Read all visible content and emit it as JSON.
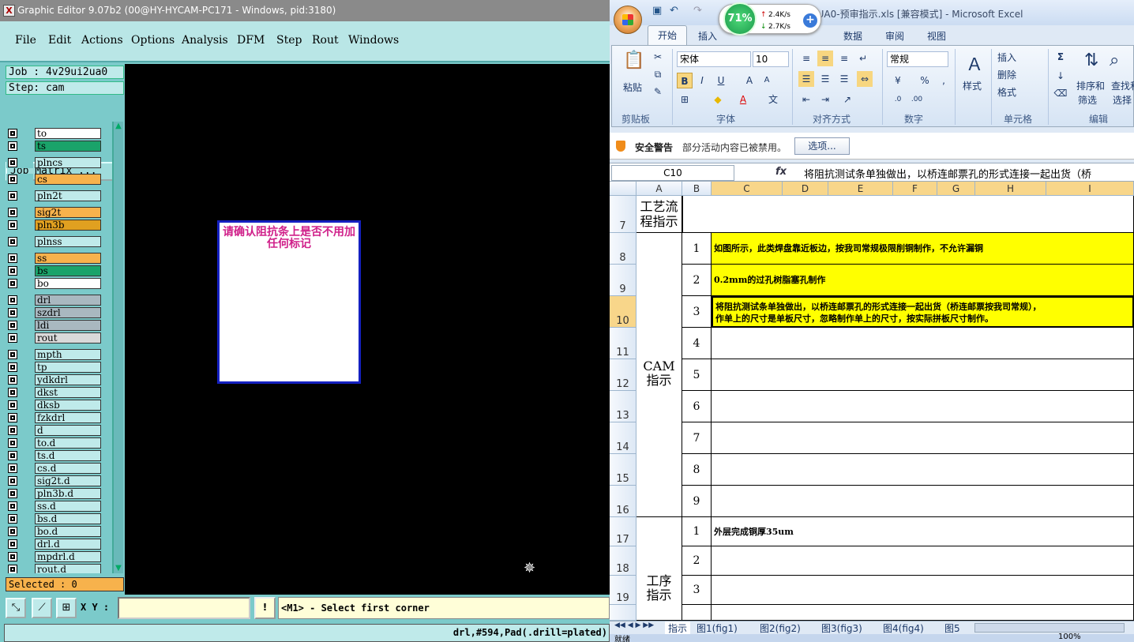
{
  "ge": {
    "title": "Graphic Editor 9.07b2 (00@HY-HYCAM-PC171 - Windows, pid:3180)",
    "menu": [
      "File",
      "Edit",
      "Actions",
      "Options",
      "Analysis",
      "DFM",
      "Step",
      "Rout",
      "Windows"
    ],
    "job": "Job : 4v29ui2ua0",
    "step": "Step: cam",
    "job_matrix": "Job Matrix ...",
    "layers": [
      {
        "name": "to",
        "color": "#ffffff"
      },
      {
        "name": "ts",
        "color": "#1aa36a"
      },
      {
        "name": "plncs",
        "color": "#bfeaea"
      },
      {
        "name": "cs",
        "color": "#f7b24c"
      },
      {
        "name": "pln2t",
        "color": "#bfeaea"
      },
      {
        "name": "sig2t",
        "color": "#f7b24c"
      },
      {
        "name": "pln3b",
        "color": "#e0a020"
      },
      {
        "name": "plnss",
        "color": "#bfeaea"
      },
      {
        "name": "ss",
        "color": "#f7b24c"
      },
      {
        "name": "bs",
        "color": "#1aa36a"
      },
      {
        "name": "bo",
        "color": "#ffffff"
      },
      {
        "name": "drl",
        "color": "#a9b8c0"
      },
      {
        "name": "szdrl",
        "color": "#a9b8c0"
      },
      {
        "name": "ldi",
        "color": "#a9b8c0"
      },
      {
        "name": "rout",
        "color": "#d9d9d9"
      },
      {
        "name": "mpth",
        "color": "#bfeaea"
      },
      {
        "name": "tp",
        "color": "#bfeaea"
      },
      {
        "name": "ydkdrl",
        "color": "#bfeaea"
      },
      {
        "name": "dkst",
        "color": "#bfeaea"
      },
      {
        "name": "dksb",
        "color": "#bfeaea"
      },
      {
        "name": "fzkdrl",
        "color": "#bfeaea"
      },
      {
        "name": "d",
        "color": "#bfeaea"
      },
      {
        "name": "to.d",
        "color": "#bfeaea"
      },
      {
        "name": "ts.d",
        "color": "#bfeaea"
      },
      {
        "name": "cs.d",
        "color": "#bfeaea"
      },
      {
        "name": "sig2t.d",
        "color": "#bfeaea"
      },
      {
        "name": "pln3b.d",
        "color": "#bfeaea"
      },
      {
        "name": "ss.d",
        "color": "#bfeaea"
      },
      {
        "name": "bs.d",
        "color": "#bfeaea"
      },
      {
        "name": "bo.d",
        "color": "#bfeaea"
      },
      {
        "name": "drl.d",
        "color": "#bfeaea"
      },
      {
        "name": "mpdrl.d",
        "color": "#bfeaea"
      },
      {
        "name": "rout.d",
        "color": "#bfeaea"
      }
    ],
    "selected": "Selected : 0",
    "popup_text": "请确认阻抗条上是否不用加任何标记",
    "xy_label": "X Y :",
    "xy_value": "",
    "excl": "!",
    "prompt": "<M1> - Select first corner",
    "status": "drl,#594,Pad(.drill=plated)"
  },
  "xl": {
    "title": "2UA0-预审指示.xls  [兼容模式] - Microsoft Excel",
    "meter": {
      "percent": "71%",
      "up": "2.4K/s",
      "down": "2.7K/s"
    },
    "tabs": [
      "开始",
      "插入",
      "数据",
      "审阅",
      "视图"
    ],
    "ribbon": {
      "paste": "粘贴",
      "clipboard": "剪贴板",
      "font_name": "宋体",
      "font_size": "10",
      "font": "字体",
      "align": "对齐方式",
      "number_format": "常规",
      "number": "数字",
      "style": "样式",
      "insert": "插入",
      "delete": "删除",
      "format": "格式",
      "cells": "单元格",
      "sort": "排序和",
      "filter": "筛选",
      "find": "查找和",
      "select": "选择",
      "edit": "编辑"
    },
    "security": {
      "title": "安全警告",
      "msg": "部分活动内容已被禁用。",
      "btn": "选项..."
    },
    "namebox": "C10",
    "formula": "将阻抗测试条单独做出，以桥连邮票孔的形式连接一起出货（桥",
    "columns": [
      "A",
      "B",
      "C",
      "D",
      "E",
      "F",
      "G",
      "H",
      "I"
    ],
    "rows": [
      "7",
      "8",
      "9",
      "10",
      "11",
      "12",
      "13",
      "14",
      "15",
      "16",
      "17",
      "18",
      "19"
    ],
    "a7": "工艺流程指示",
    "a_cam": "CAM指示",
    "a_proc": "工序指示",
    "b": [
      "1",
      "2",
      "3",
      "4",
      "5",
      "6",
      "7",
      "8",
      "9",
      "1",
      "2",
      "3"
    ],
    "c8": "如图所示，此类焊盘靠近板边，按我司常规极限削铜制作，不允许漏铜",
    "c9": "0.2mm的过孔树脂塞孔制作",
    "c10a": "将阻抗测试条单独做出，以桥连邮票孔的形式连接一起出货（桥连邮票按我司常规），",
    "c10b": "作单上的尺寸是单板尺寸，忽略制作单上的尺寸，按实际拼板尺寸制作。",
    "c17": "外层完成铜厚35um",
    "sheets": [
      "指示",
      "图1(fig1)",
      "图2(fig2)",
      "图3(fig3)",
      "图4(fig4)",
      "图5"
    ],
    "status": "就绪",
    "zoom": "100%"
  }
}
